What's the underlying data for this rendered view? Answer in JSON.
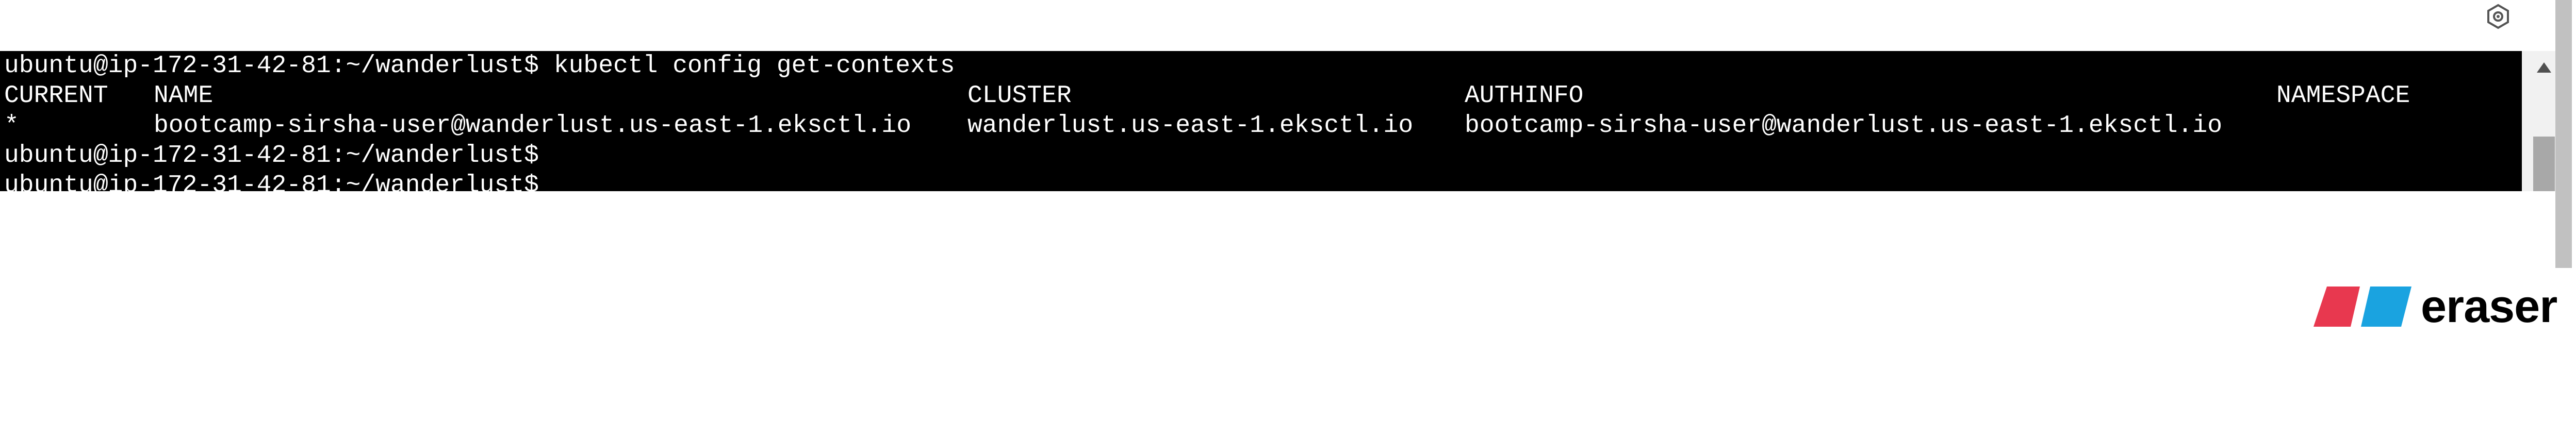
{
  "top_icon": "settings-hex-icon",
  "terminal": {
    "lines": [
      "ubuntu@ip-172-31-42-81:~/wanderlust$ kubectl config get-contexts",
      "",
      "",
      "ubuntu@ip-172-31-42-81:~/wanderlust$",
      "ubuntu@ip-172-31-42-81:~/wanderlust$"
    ],
    "table": {
      "headers": [
        "CURRENT",
        "NAME",
        "CLUSTER",
        "AUTHINFO",
        "NAMESPACE"
      ],
      "rows": [
        [
          "*",
          "bootcamp-sirsha-user@wanderlust.us-east-1.eksctl.io",
          "wanderlust.us-east-1.eksctl.io",
          "bootcamp-sirsha-user@wanderlust.us-east-1.eksctl.io",
          ""
        ]
      ]
    },
    "background": "#000000",
    "foreground": "#ffffff"
  },
  "scrollbar": {
    "up_icon": "scroll-up-arrow-icon"
  },
  "logo": {
    "text": "eraser",
    "colors": [
      "#e8384f",
      "#1aa3e0"
    ]
  }
}
